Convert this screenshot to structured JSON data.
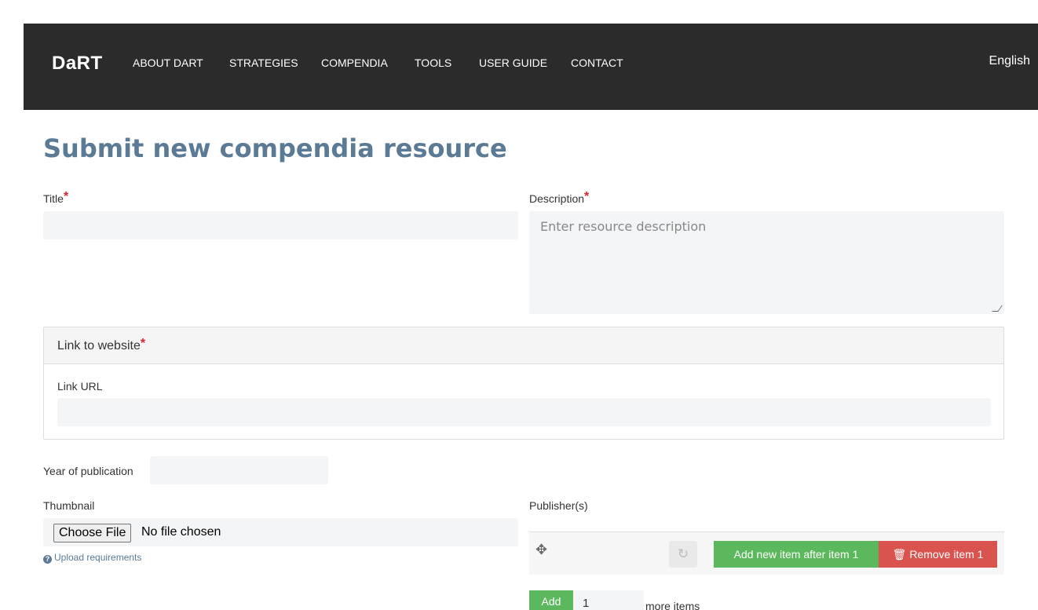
{
  "nav": {
    "brand": "DaRT",
    "items": [
      "ABOUT DART",
      "STRATEGIES",
      "COMPENDIA",
      "TOOLS",
      "USER GUIDE",
      "CONTACT"
    ],
    "language": "English"
  },
  "page": {
    "title": "Submit new compendia resource"
  },
  "form": {
    "title_label": "Title",
    "description_label": "Description",
    "description_placeholder": "Enter resource description",
    "required_mark": "*",
    "link_panel_title": "Link to website",
    "link_url_label": "Link URL",
    "year_label": "Year of publication",
    "thumbnail_label": "Thumbnail",
    "file_button": "Choose File",
    "file_status": "No file chosen",
    "upload_help": "Upload requirements",
    "publishers_label": "Publisher(s)",
    "add_after_label": "Add new item after item 1",
    "remove_label": "Remove item 1",
    "add_label": "Add",
    "add_count": "1",
    "more_items_label": "more items"
  },
  "colors": {
    "navbar_bg": "#2b2b2b",
    "title_color": "#5b7a96",
    "required": "#d9232d",
    "green": "#5cb85c",
    "red": "#d9534f"
  },
  "icons": {
    "move": "move-icon",
    "refresh": "refresh-icon",
    "trash": "trash-icon",
    "help": "question-circle-icon"
  }
}
